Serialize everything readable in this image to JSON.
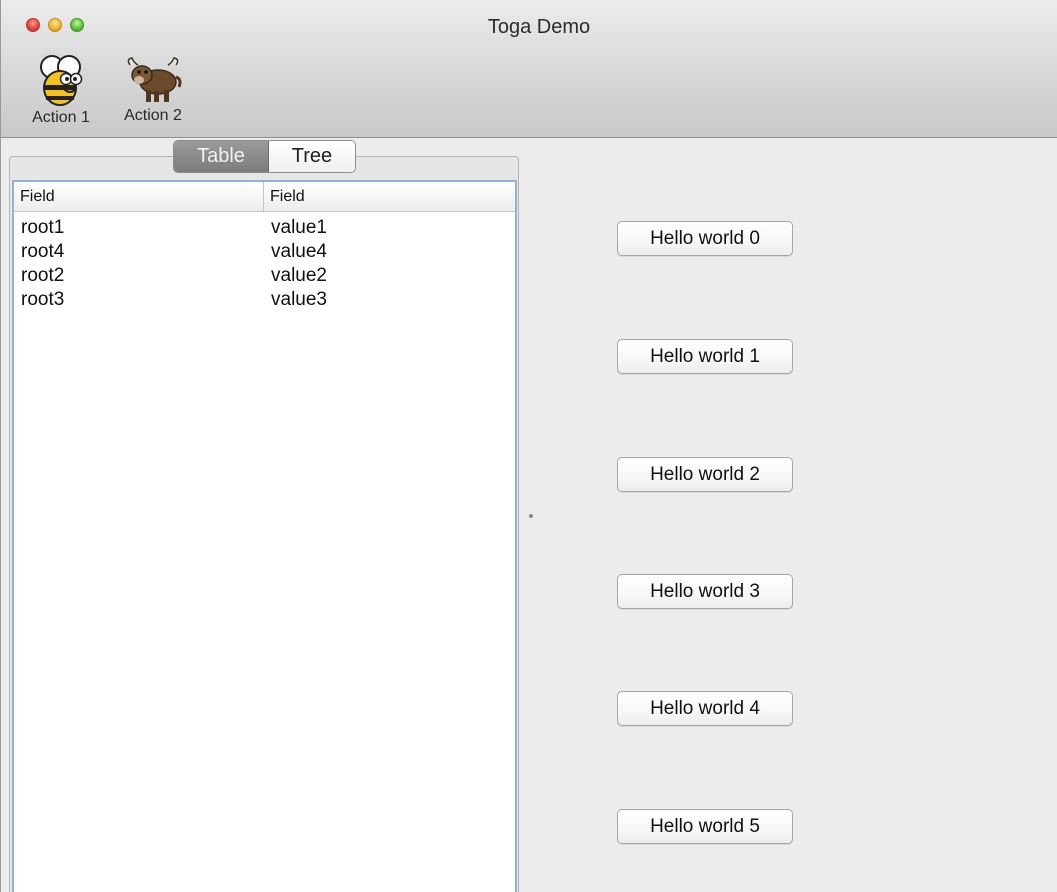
{
  "window": {
    "title": "Toga Demo"
  },
  "toolbar": {
    "items": [
      {
        "label": "Action 1",
        "icon": "bee-icon"
      },
      {
        "label": "Action 2",
        "icon": "yak-icon"
      }
    ]
  },
  "tabs": {
    "items": [
      "Table",
      "Tree"
    ],
    "selected": "Table"
  },
  "table": {
    "columns": [
      "Field",
      "Field"
    ],
    "rows": [
      [
        "root1",
        "value1"
      ],
      [
        "root4",
        "value4"
      ],
      [
        "root2",
        "value2"
      ],
      [
        "root3",
        "value3"
      ]
    ]
  },
  "buttons": [
    "Hello world 0",
    "Hello world 1",
    "Hello world 2",
    "Hello world 3",
    "Hello world 4",
    "Hello world 5"
  ],
  "colors": {
    "selected_tab": "#878787",
    "table_focus_border": "#8fb2d8"
  }
}
